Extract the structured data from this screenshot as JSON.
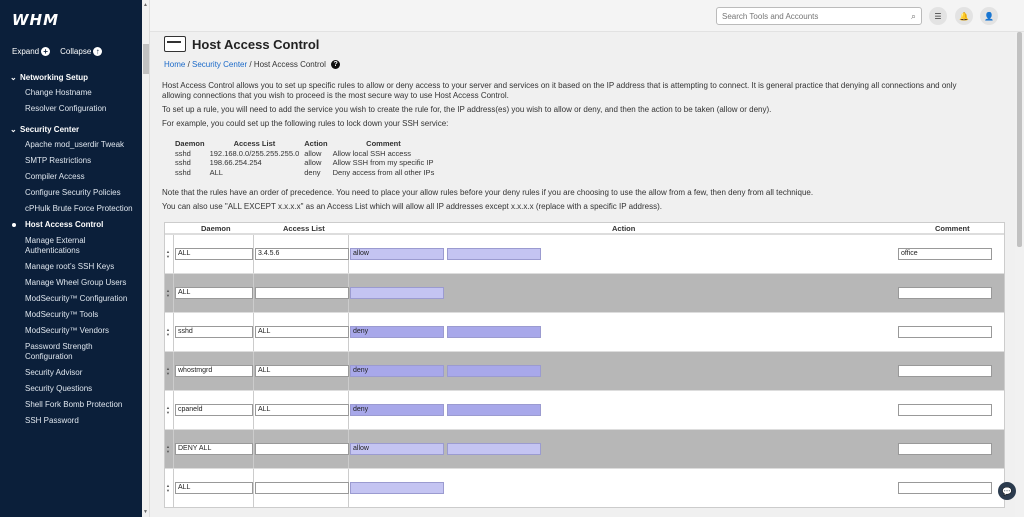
{
  "sidebar": {
    "logo": "WHM",
    "expand_label": "Expand",
    "collapse_label": "Collapse",
    "sections": [
      {
        "title": "Networking Setup",
        "items": [
          "Change Hostname",
          "Resolver Configuration"
        ]
      },
      {
        "title": "Security Center",
        "items": [
          "Apache mod_userdir Tweak",
          "SMTP Restrictions",
          "Compiler Access",
          "Configure Security Policies",
          "cPHulk Brute Force Protection",
          "Host Access Control",
          "Manage External Authentications",
          "Manage root’s SSH Keys",
          "Manage Wheel Group Users",
          "ModSecurity™ Configuration",
          "ModSecurity™ Tools",
          "ModSecurity™ Vendors",
          "Password Strength Configuration",
          "Security Advisor",
          "Security Questions",
          "Shell Fork Bomb Protection",
          "SSH Password"
        ]
      }
    ],
    "active_item": "Host Access Control"
  },
  "topbar": {
    "search_placeholder": "Search Tools and Accounts"
  },
  "page": {
    "title": "Host Access Control",
    "breadcrumb": [
      "Home",
      "Security Center",
      "Host Access Control"
    ],
    "intro1": "Host Access Control allows you to set up specific rules to allow or deny access to your server and services on it based on the IP address that is attempting to connect. It is general practice that denying all connections and only allowing connections that you wish to proceed is the most secure way to use Host Access Control.",
    "intro2": "To set up a rule, you will need to add the service you wish to create the rule for, the IP address(es) you wish to allow or deny, and then the action to be taken (allow or deny).",
    "intro3": "For example, you could set up the following rules to lock down your SSH service:",
    "note1": "Note that the rules have an order of precedence. You need to place your allow rules before your deny rules if you are choosing to use the allow from a few, then deny from all technique.",
    "note2": "You can also use \"ALL EXCEPT x.x.x.x\" as an Access List which will allow all IP addresses except x.x.x.x (replace with a specific IP address)."
  },
  "example": {
    "headers": [
      "Daemon",
      "Access List",
      "Action",
      "Comment"
    ],
    "rows": [
      [
        "sshd",
        "192.168.0.0/255.255.255.0",
        "allow",
        "Allow local SSH access"
      ],
      [
        "sshd",
        "198.66.254.254",
        "allow",
        "Allow SSH from my specific IP"
      ],
      [
        "sshd",
        "ALL",
        "deny",
        "Deny access from all other IPs"
      ]
    ]
  },
  "rules": {
    "headers": [
      "Daemon",
      "Access List",
      "Action",
      "Comment"
    ],
    "rows": [
      {
        "daemon": "ALL",
        "access": "3.4.5.6",
        "action": "allow",
        "comment": "office"
      },
      {
        "daemon": "ALL",
        "access": "",
        "action": "",
        "comment": ""
      },
      {
        "daemon": "sshd",
        "access": "ALL",
        "action": "deny",
        "comment": ""
      },
      {
        "daemon": "whostmgrd",
        "access": "ALL",
        "action": "deny",
        "comment": ""
      },
      {
        "daemon": "cpaneld",
        "access": "ALL",
        "action": "deny",
        "comment": ""
      },
      {
        "daemon": "DENY ALL",
        "access": "",
        "action": "allow",
        "comment": ""
      },
      {
        "daemon": "ALL",
        "access": "",
        "action": "",
        "comment": ""
      }
    ]
  }
}
